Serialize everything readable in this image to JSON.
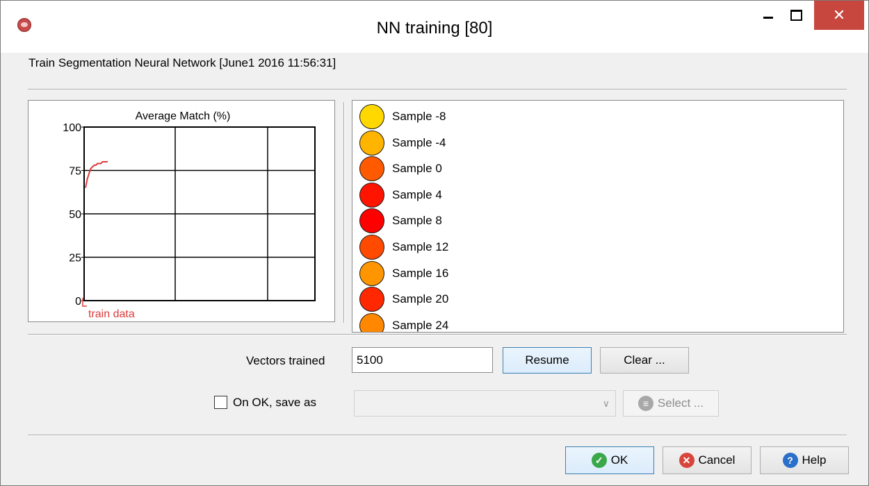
{
  "window": {
    "title": "NN training [80]",
    "close_glyph": "✕"
  },
  "subtitle": "Train Segmentation Neural Network [June1 2016 11:56:31]",
  "chart_data": {
    "type": "line",
    "title": "Average Match (%)",
    "y_ticks": [
      "100",
      "75",
      "50",
      "25",
      "0"
    ],
    "ylim": [
      0,
      100
    ],
    "grid": true,
    "legend": "bottom-left",
    "series": [
      {
        "name": "train data",
        "color": "#dd3b3b",
        "y": [
          65,
          70,
          73,
          76,
          77,
          78,
          78,
          79,
          79,
          79,
          80,
          80,
          80,
          80
        ]
      }
    ]
  },
  "samples": [
    {
      "label": "Sample -8",
      "color": "#ffd800"
    },
    {
      "label": "Sample -4",
      "color": "#ffb400"
    },
    {
      "label": "Sample 0",
      "color": "#ff5a00"
    },
    {
      "label": "Sample 4",
      "color": "#ff1400"
    },
    {
      "label": "Sample 8",
      "color": "#ff0000"
    },
    {
      "label": "Sample 12",
      "color": "#ff4a00"
    },
    {
      "label": "Sample 16",
      "color": "#ff9600"
    },
    {
      "label": "Sample 20",
      "color": "#ff2800"
    },
    {
      "label": "Sample 24",
      "color": "#ff8800"
    }
  ],
  "vectors": {
    "label": "Vectors trained",
    "value": "5100"
  },
  "buttons": {
    "resume": "Resume",
    "clear": "Clear ...",
    "select": "Select ...",
    "ok": "OK",
    "cancel": "Cancel",
    "help": "Help"
  },
  "save": {
    "checkbox_label": "On OK, save as",
    "selected": ""
  }
}
